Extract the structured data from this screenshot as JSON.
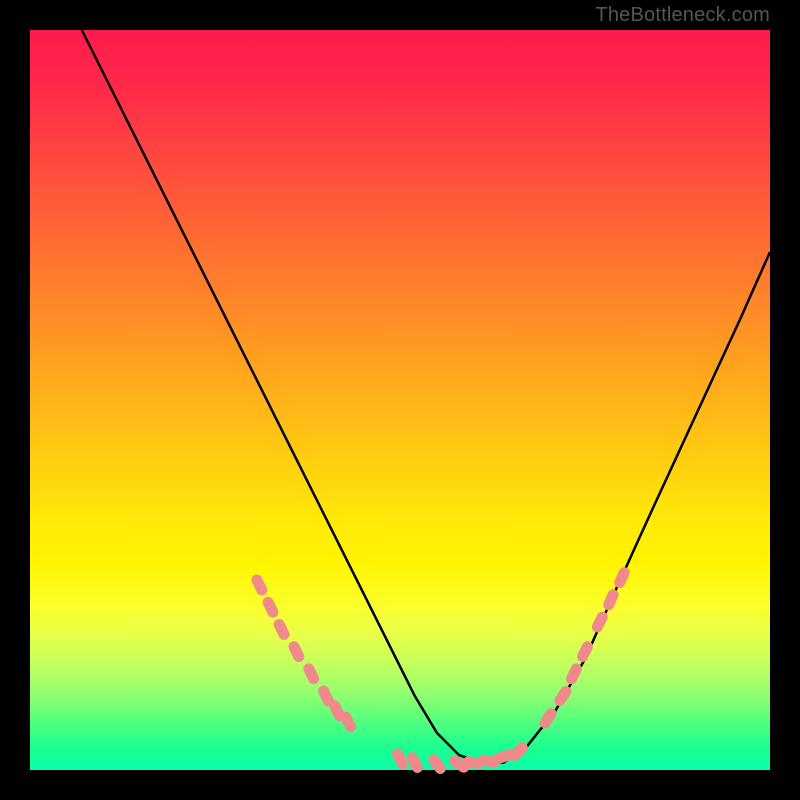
{
  "attribution": "TheBottleneck.com",
  "chart_data": {
    "type": "line",
    "title": "",
    "xlabel": "",
    "ylabel": "",
    "xlim": [
      0,
      100
    ],
    "ylim": [
      0,
      100
    ],
    "grid": false,
    "legend": false,
    "series": [
      {
        "name": "curve",
        "color": "#000000",
        "x": [
          7,
          12,
          18,
          24,
          30,
          35,
          40,
          44,
          48,
          52,
          55,
          58,
          61,
          64,
          67,
          71,
          75,
          79,
          84,
          90,
          96,
          100
        ],
        "y": [
          100,
          90,
          78,
          66,
          54,
          44,
          34,
          26,
          18,
          10,
          5,
          2,
          1,
          1,
          3,
          8,
          15,
          24,
          35,
          48,
          61,
          70
        ]
      }
    ],
    "markers": [
      {
        "name": "left-cluster",
        "color": "#f08a8a",
        "shape": "rounded-bar",
        "points": [
          {
            "x": 31,
            "y": 25
          },
          {
            "x": 32.5,
            "y": 22
          },
          {
            "x": 34,
            "y": 19
          },
          {
            "x": 36,
            "y": 16
          },
          {
            "x": 38,
            "y": 13
          },
          {
            "x": 40,
            "y": 10
          },
          {
            "x": 41.5,
            "y": 8
          },
          {
            "x": 43,
            "y": 6.5
          }
        ]
      },
      {
        "name": "bottom-cluster",
        "color": "#f08a8a",
        "shape": "rounded-bar",
        "points": [
          {
            "x": 50,
            "y": 1.5
          },
          {
            "x": 52,
            "y": 1
          },
          {
            "x": 55,
            "y": 0.8
          },
          {
            "x": 58,
            "y": 0.8
          },
          {
            "x": 60,
            "y": 1
          },
          {
            "x": 62,
            "y": 1.2
          },
          {
            "x": 64,
            "y": 1.8
          },
          {
            "x": 66,
            "y": 2.5
          }
        ]
      },
      {
        "name": "right-cluster",
        "color": "#f08a8a",
        "shape": "rounded-bar",
        "points": [
          {
            "x": 70,
            "y": 7
          },
          {
            "x": 72,
            "y": 10
          },
          {
            "x": 73.5,
            "y": 13
          },
          {
            "x": 75,
            "y": 16
          },
          {
            "x": 77,
            "y": 20
          },
          {
            "x": 78.5,
            "y": 23
          },
          {
            "x": 80,
            "y": 26
          }
        ]
      }
    ]
  }
}
